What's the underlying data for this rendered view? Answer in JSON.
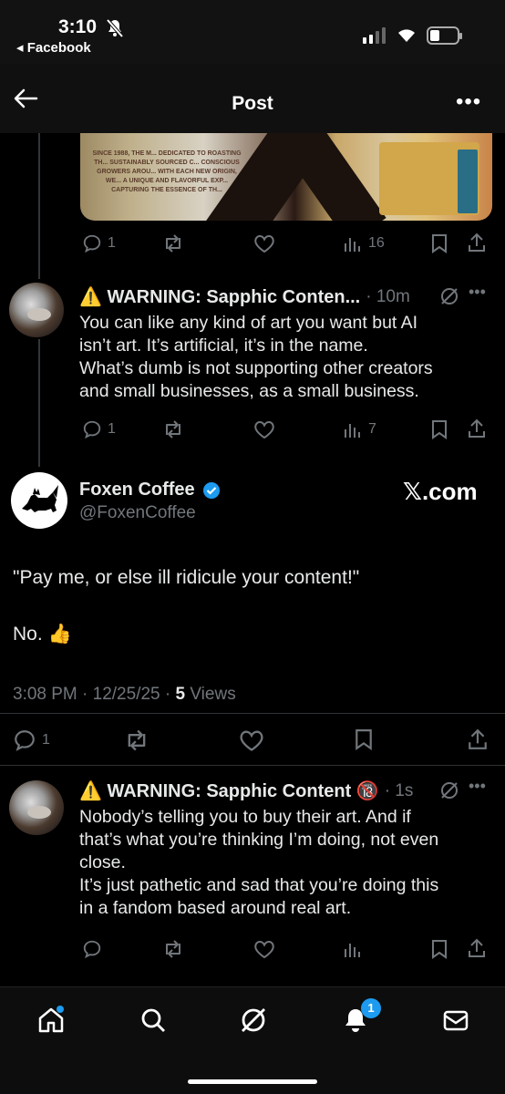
{
  "status_bar": {
    "time": "3:10",
    "back_app": "◂ Facebook"
  },
  "header": {
    "title": "Post"
  },
  "media_text": "SINCE 1988, THE M... DEDICATED TO ROASTING TH... SUSTAINABLY SOURCED C... CONSCIOUS GROWERS AROU... WITH EACH NEW ORIGIN, WE... A UNIQUE AND FLAVORFUL EXP... CAPTURING THE ESSENCE OF TH...",
  "media_actions": {
    "replies": "1",
    "views": "16"
  },
  "reply1": {
    "name": "⚠️ WARNING: Sapphic Conten...",
    "time": "· 10m",
    "text_lines": [
      "You can like any kind of art you want but AI",
      "isn’t art. It’s artificial, it’s in the name.",
      "What’s dumb is not supporting other creators",
      "and small businesses, as a small business."
    ],
    "replies": "1",
    "views": "7"
  },
  "main_post": {
    "name": "Foxen Coffee",
    "handle": "@FoxenCoffee",
    "link": "𝕏.com",
    "line1": "\"Pay me, or else ill ridicule your content!\"",
    "line2": "No. 👍",
    "timestamp": "3:08 PM · 12/25/25 · ",
    "views_count": "5",
    "views_label": " Views",
    "replies": "1"
  },
  "reply2": {
    "name": "⚠️ WARNING: Sapphic Content 🔞",
    "time": "· 1s",
    "text_lines": [
      "Nobody’s telling you to buy their art. And if",
      "that’s what you’re thinking I’m doing, not even",
      "close.",
      "It’s just pathetic and sad that you’re doing this",
      "in a fandom based around real art."
    ]
  },
  "nav": {
    "notifications_badge": "1"
  },
  "colors": {
    "accent": "#1d9bf0",
    "muted": "#71767b",
    "text": "#e7e9ea",
    "background": "#000000"
  }
}
